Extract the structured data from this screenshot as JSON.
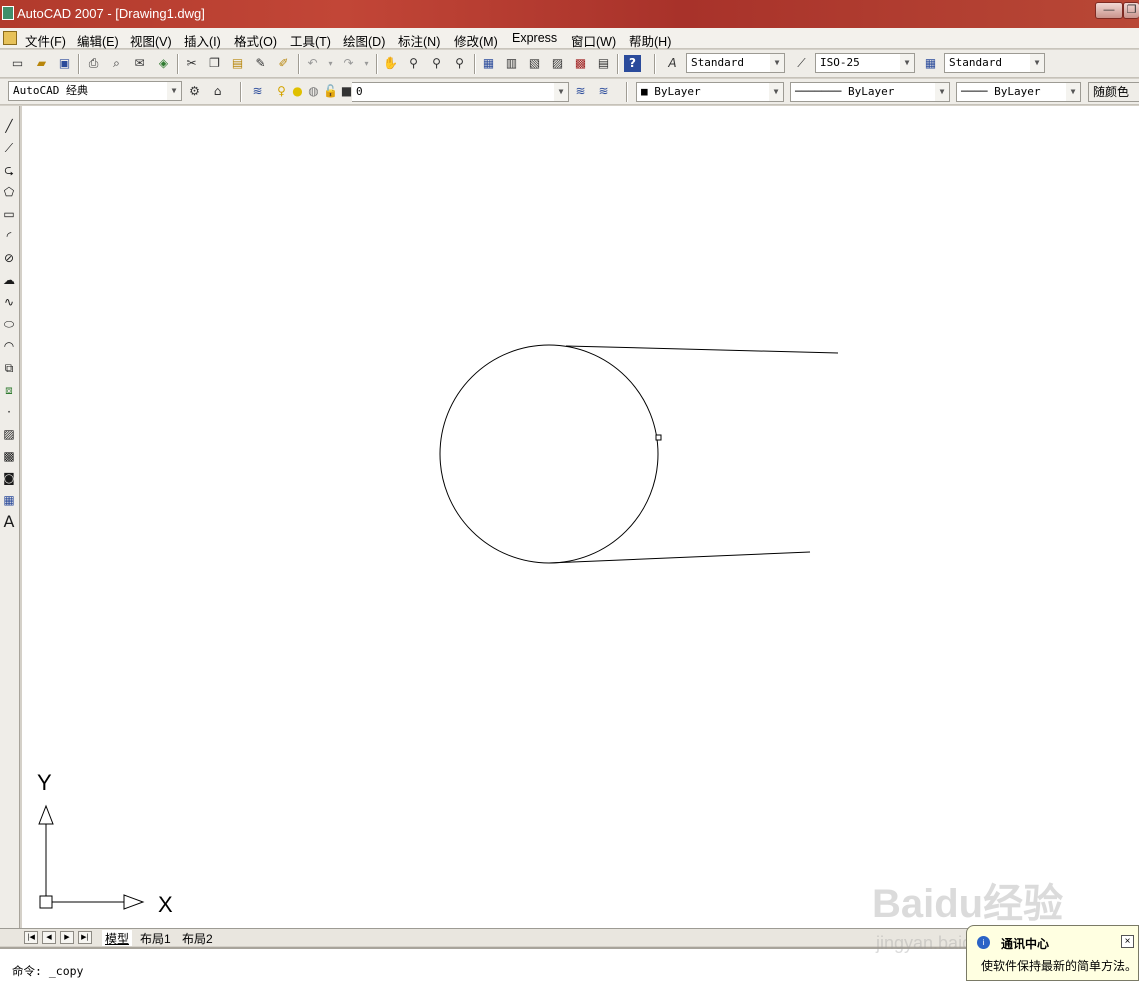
{
  "window": {
    "title": "AutoCAD 2007 - [Drawing1.dwg]",
    "minimize_label": "—",
    "restore_label": "❐"
  },
  "menu": {
    "items": [
      "文件(F)",
      "编辑(E)",
      "视图(V)",
      "插入(I)",
      "格式(O)",
      "工具(T)",
      "绘图(D)",
      "标注(N)",
      "修改(M)",
      "Express",
      "窗口(W)",
      "帮助(H)"
    ]
  },
  "toolbar1": {
    "text_style": "Standard",
    "dim_style": "ISO-25",
    "table_style": "Standard"
  },
  "toolbar2": {
    "workspace": "AutoCAD 经典",
    "layer": "0",
    "color": "ByLayer",
    "linetype": "ByLayer",
    "lineweight": "ByLayer",
    "plot_style": "随颜色"
  },
  "ucs": {
    "x_label": "X",
    "y_label": "Y"
  },
  "tabs": {
    "items": [
      "模型",
      "布局1",
      "布局2"
    ],
    "active": "模型"
  },
  "command": {
    "text": "命令:  _copy"
  },
  "notification": {
    "title": "通讯中心",
    "body": "使软件保持最新的简单方法。",
    "close_label": "×"
  },
  "watermark": {
    "text": "Baidu经验",
    "url": "jingyan.baidu.com"
  },
  "colors": {
    "titlebar": "#b13a2c",
    "canvas": "#ffffff",
    "chrome": "#efede8"
  }
}
